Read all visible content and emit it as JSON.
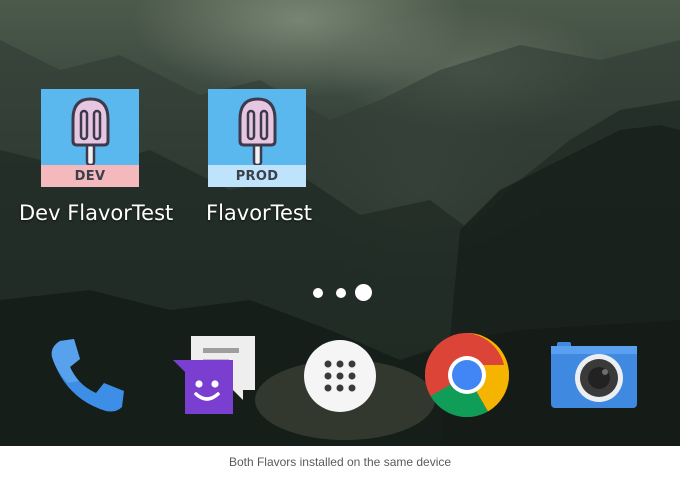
{
  "home_screen": {
    "apps": [
      {
        "label": "Dev FlavorTest",
        "badge": "DEV",
        "background": "#5bb8ee",
        "badge_color": "#f4b9bd",
        "icon": "popsicle-icon"
      },
      {
        "label": "FlavorTest",
        "badge": "PROD",
        "background": "#5bb8ee",
        "badge_color": "#bfe3fb",
        "icon": "popsicle-icon"
      }
    ],
    "page_indicator": {
      "pages": 3,
      "current_page": 3
    },
    "dock": [
      {
        "name": "phone",
        "icon": "phone-icon"
      },
      {
        "name": "messages",
        "icon": "messages-icon"
      },
      {
        "name": "app drawer",
        "icon": "app-drawer-icon"
      },
      {
        "name": "chrome",
        "icon": "chrome-icon"
      },
      {
        "name": "camera",
        "icon": "camera-icon"
      }
    ]
  },
  "caption": "Both Flavors installed on the same device",
  "colors": {
    "popsicle_fill": "#e6c6e0",
    "popsicle_outline": "#3c3a4c",
    "phone_blue": "#3d8ee6",
    "messages_purple": "#7a3fd0",
    "camera_blue": "#3f8ae0"
  }
}
